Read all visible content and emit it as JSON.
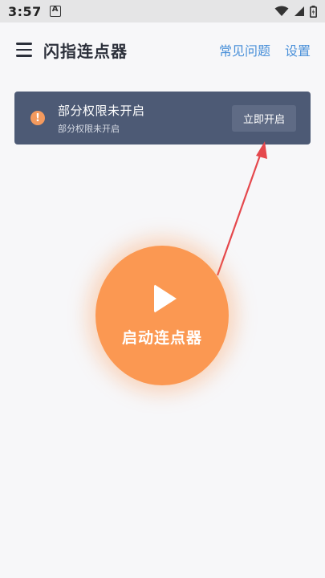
{
  "status_bar": {
    "time": "3:57",
    "app_badge": "A",
    "icons": [
      "wifi-icon",
      "signal-icon",
      "battery-icon"
    ]
  },
  "app_bar": {
    "title": "闪指连点器",
    "faq_link": "常见问题",
    "settings_link": "设置"
  },
  "permission_banner": {
    "title": "部分权限未开启",
    "subtitle": "部分权限未开启",
    "button_label": "立即开启",
    "icon": "warning-icon"
  },
  "start_button": {
    "label": "启动连点器",
    "icon": "play-icon"
  },
  "colors": {
    "accent": "#fb9852",
    "banner_bg": "#4d5a75",
    "link": "#4a90d9",
    "arrow": "#e5484d"
  }
}
